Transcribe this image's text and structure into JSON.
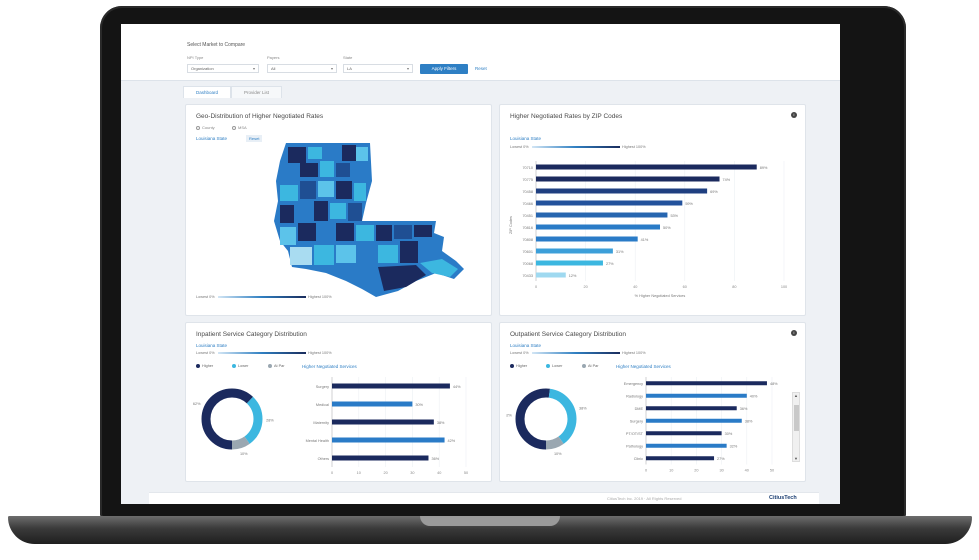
{
  "filters": {
    "title": "Select Market to Compare",
    "labels": [
      "NPI Type",
      "Payers",
      "State"
    ],
    "values": [
      "Organization",
      "All",
      "LA"
    ],
    "apply_label": "Apply Filters",
    "reset_label": "Reset"
  },
  "tabs": [
    "Dashboard",
    "Provider List"
  ],
  "geo": {
    "title": "Geo-Distribution of Higher Negotiated Rates",
    "radio_1": "County",
    "radio_2": "MSA",
    "state_link": "Louisiana State",
    "reset_chip": "Reset",
    "legend_low": "Lowest 0%",
    "legend_high": "Highest 100%"
  },
  "zip": {
    "title": "Higher Negotiated Rates by ZIP Codes",
    "state": "Louisiana State",
    "legend_low": "Lowest 0%",
    "legend_high": "Highest 100%",
    "ylabel": "ZIP Codes",
    "xlabel": "% Higher Negotiated Services"
  },
  "inpatient": {
    "title": "Inpatient Service Category Distribution",
    "state": "Louisiana State",
    "legend_low": "Lowest 0%",
    "legend_high": "Highest 100%",
    "legend_items": [
      "Higher",
      "Lower",
      "At Par"
    ],
    "bars_title": "Higher Negotiated Services"
  },
  "outpatient": {
    "title": "Outpatient Service Category Distribution",
    "state": "Louisiana State",
    "legend_low": "Lowest 0%",
    "legend_high": "Highest 100%",
    "legend_items": [
      "Higher",
      "Lower",
      "At Par"
    ],
    "bars_title": "Higher Negotiated Services"
  },
  "footer": {
    "copyright": "CitiusTech Inc. 2019 · All Rights Reserved",
    "brand": "CitiusTech"
  },
  "colors": {
    "dark": "#1b2a5e",
    "mid": "#2a7bc7",
    "light": "#3cb7e0",
    "gray": "#9aa7b1"
  },
  "chart_data": [
    {
      "type": "bar",
      "title": "Higher Negotiated Rates by ZIP Codes",
      "categories": [
        "70710",
        "70775",
        "70458",
        "70466",
        "70451",
        "70816",
        "70808",
        "70601",
        "70068",
        "70433"
      ],
      "values": [
        89,
        74,
        69,
        59,
        53,
        50,
        41,
        31,
        27,
        12
      ],
      "labels": [
        "89%",
        "74%",
        "69%",
        "59%",
        "53%",
        "50%",
        "41%",
        "31%",
        "27%",
        "12%"
      ],
      "xlabel": "% Higher Negotiated Services",
      "ylabel": "ZIP Codes",
      "xlim": [
        0,
        100
      ],
      "xticks": [
        "0",
        "20",
        "40",
        "60",
        "80",
        "100"
      ]
    },
    {
      "type": "pie",
      "title": "Inpatient Service Category Distribution",
      "categories": [
        "Higher",
        "Lower",
        "At Par"
      ],
      "values": [
        62,
        28,
        10
      ],
      "labels": [
        "62%",
        "28%",
        "10%"
      ]
    },
    {
      "type": "bar",
      "title": "Higher Negotiated Services",
      "categories": [
        "Surgery",
        "Medical",
        "Maternity",
        "Mental Health",
        "Others"
      ],
      "values": [
        44,
        30,
        38,
        42,
        36
      ],
      "labels": [
        "44%",
        "30%",
        "38%",
        "42%",
        "36%"
      ],
      "xlim": [
        0,
        50
      ],
      "xticks": [
        "0",
        "10",
        "20",
        "30",
        "40",
        "50"
      ]
    },
    {
      "type": "pie",
      "title": "Outpatient Service Category Distribution",
      "categories": [
        "Higher",
        "Lower",
        "At Par"
      ],
      "values": [
        52,
        38,
        10
      ],
      "labels": [
        "52%",
        "38%",
        "10%"
      ]
    },
    {
      "type": "bar",
      "title": "Higher Negotiated Services",
      "categories": [
        "Emergency",
        "Radiology",
        "DME",
        "Surgery",
        "PT/OT/ST",
        "Pathology",
        "Clinic"
      ],
      "values": [
        48,
        40,
        36,
        38,
        30,
        32,
        27
      ],
      "labels": [
        "48%",
        "40%",
        "36%",
        "38%",
        "30%",
        "32%",
        "27%"
      ],
      "xlim": [
        0,
        50
      ],
      "xticks": [
        "0",
        "10",
        "20",
        "30",
        "40",
        "50"
      ]
    }
  ]
}
